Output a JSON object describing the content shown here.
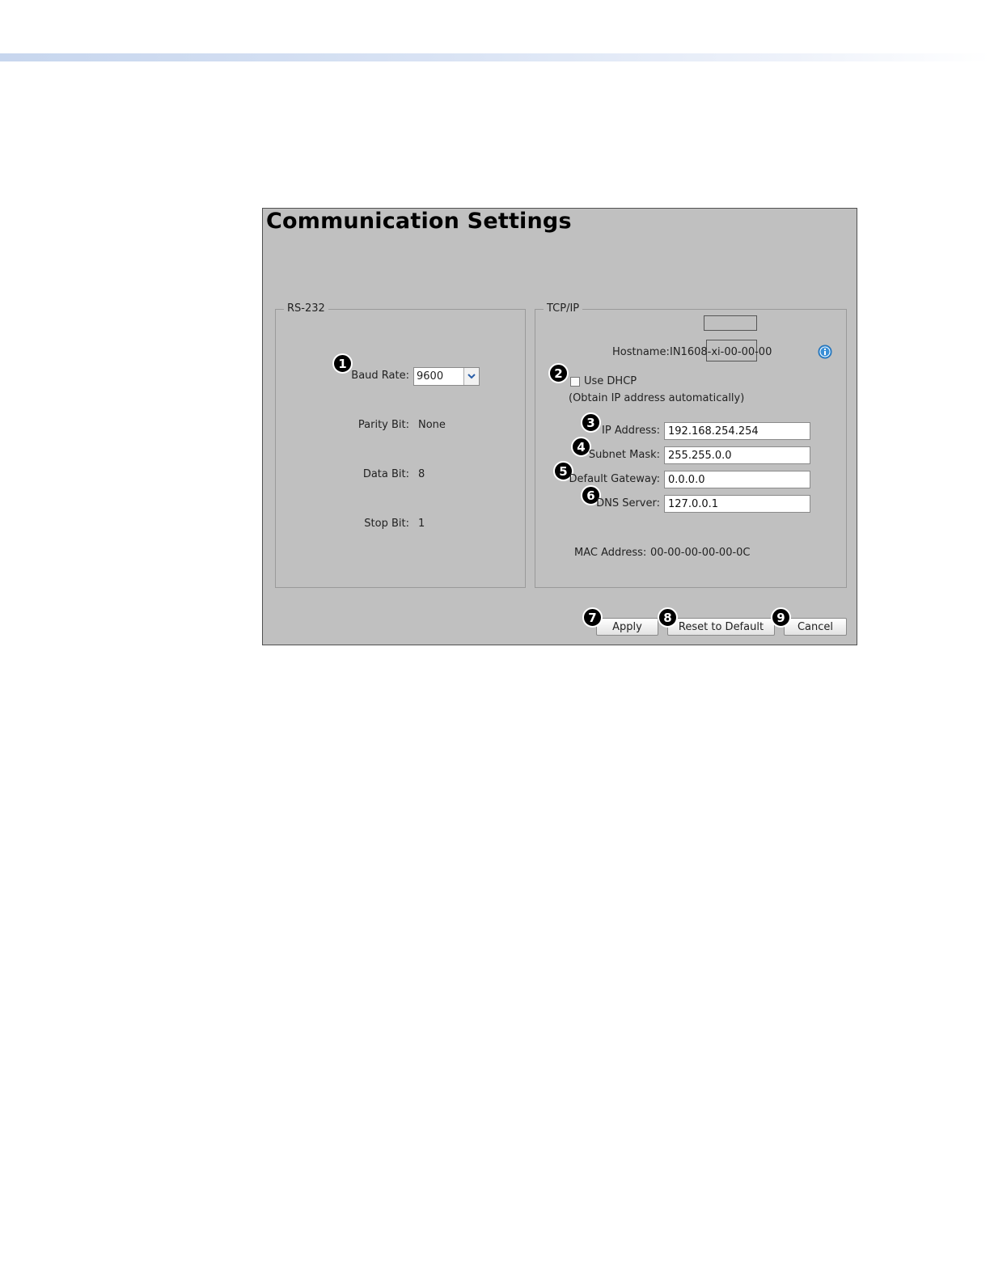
{
  "panel": {
    "title": "Communication Settings"
  },
  "rs232": {
    "legend": "RS-232",
    "baud_rate_label": "Baud Rate:",
    "baud_rate_value": "9600",
    "parity_label": "Parity Bit:",
    "parity_value": "None",
    "data_bit_label": "Data Bit:",
    "data_bit_value": "8",
    "stop_bit_label": "Stop Bit:",
    "stop_bit_value": "1"
  },
  "tcpip": {
    "legend": "TCP/IP",
    "hostname_label": "Hostname:",
    "hostname_value": "IN1608-xi-00-00-00",
    "dhcp_label": "Use DHCP",
    "dhcp_checked": false,
    "dhcp_note": "(Obtain IP address automatically)",
    "ip_label": "IP Address:",
    "ip_value": "192.168.254.254",
    "subnet_label": "Subnet Mask:",
    "subnet_value": "255.255.0.0",
    "gateway_label": "Default Gateway:",
    "gateway_value": "0.0.0.0",
    "dns_label": "DNS Server:",
    "dns_value": "127.0.0.1",
    "mac_label": "MAC Address:",
    "mac_value": "00-00-00-00-00-0C"
  },
  "buttons": {
    "apply": "Apply",
    "reset": "Reset to Default",
    "cancel": "Cancel"
  },
  "callouts": [
    "1",
    "2",
    "3",
    "4",
    "5",
    "6",
    "7",
    "8",
    "9"
  ],
  "colors": {
    "panel_bg": "#c0c0c0",
    "badge": "#000000",
    "info_icon": "#3a8fd6"
  },
  "icons": {
    "info": "info-icon",
    "dropdown": "chevron-down-icon"
  }
}
